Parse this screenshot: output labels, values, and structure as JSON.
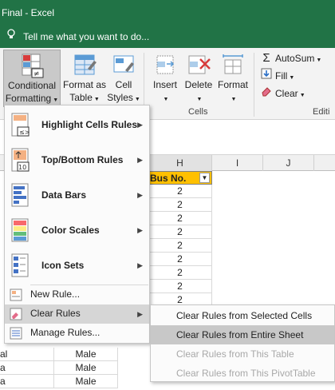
{
  "window": {
    "title": "Final - Excel"
  },
  "tell_me": {
    "placeholder": "Tell me what you want to do..."
  },
  "ribbon": {
    "conditional_formatting": {
      "line1": "Conditional",
      "line2": "Formatting"
    },
    "format_as_table": {
      "line1": "Format as",
      "line2": "Table"
    },
    "cell_styles": {
      "line1": "Cell",
      "line2": "Styles"
    },
    "insert": "Insert",
    "delete": "Delete",
    "format": "Format",
    "cells_group": "Cells",
    "autosum": "AutoSum",
    "fill": "Fill",
    "clear": "Clear",
    "editing_group": "Editi"
  },
  "columns": {
    "h": "H",
    "i": "I",
    "j": "J"
  },
  "sheet": {
    "header_bus": "Bus No.",
    "bus_values": [
      "2",
      "2",
      "2",
      "2",
      "2",
      "2",
      "2",
      "2",
      "2"
    ],
    "left_fragments": [
      "al",
      "a",
      "a"
    ],
    "gender_values": [
      "Male",
      "Male",
      "Male"
    ]
  },
  "cf_menu": {
    "highlight_cells_rules": "Highlight Cells Rules",
    "top_bottom_rules": "Top/Bottom Rules",
    "data_bars": "Data Bars",
    "color_scales": "Color Scales",
    "icon_sets": "Icon Sets",
    "new_rule": "New Rule...",
    "clear_rules": "Clear Rules",
    "manage_rules": "Manage Rules..."
  },
  "clear_submenu": {
    "selected_cells": "Clear Rules from Selected Cells",
    "entire_sheet": "Clear Rules from Entire Sheet",
    "this_table": "Clear Rules from This Table",
    "this_pivot": "Clear Rules from This PivotTable"
  },
  "colors": {
    "excel_green": "#217346",
    "header_fill": "#ffc000",
    "menu_hover": "#d6d6d6"
  }
}
